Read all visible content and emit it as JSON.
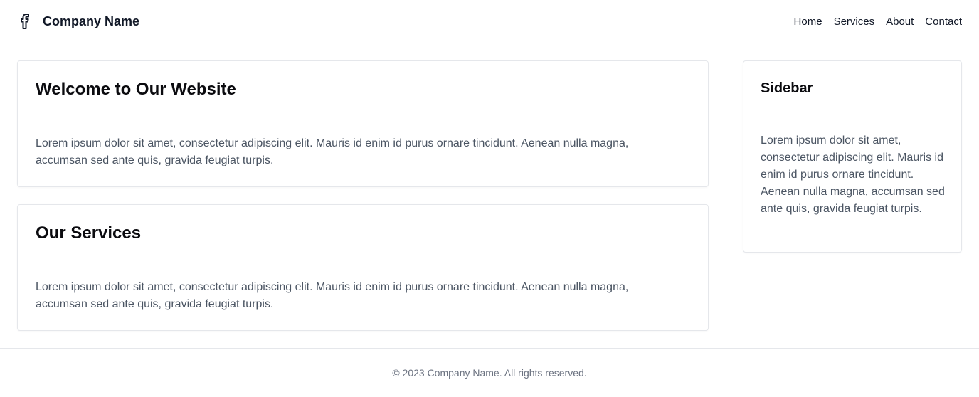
{
  "header": {
    "brand_icon": "facebook-icon",
    "brand_name": "Company Name",
    "nav": [
      {
        "label": "Home"
      },
      {
        "label": "Services"
      },
      {
        "label": "About"
      },
      {
        "label": "Contact"
      }
    ]
  },
  "main": {
    "welcome": {
      "title": "Welcome to Our Website",
      "body": "Lorem ipsum dolor sit amet, consectetur adipiscing elit. Mauris id enim id purus ornare tincidunt. Aenean nulla magna, accumsan sed ante quis, gravida feugiat turpis."
    },
    "services": {
      "title": "Our Services",
      "body": "Lorem ipsum dolor sit amet, consectetur adipiscing elit. Mauris id enim id purus ornare tincidunt. Aenean nulla magna, accumsan sed ante quis, gravida feugiat turpis."
    }
  },
  "sidebar": {
    "title": "Sidebar",
    "body": "Lorem ipsum dolor sit amet, consectetur adipiscing elit. Mauris id enim id purus ornare tincidunt. Aenean nulla magna, accumsan sed ante quis, gravida feugiat turpis."
  },
  "footer": {
    "text": "© 2023 Company Name. All rights reserved."
  }
}
